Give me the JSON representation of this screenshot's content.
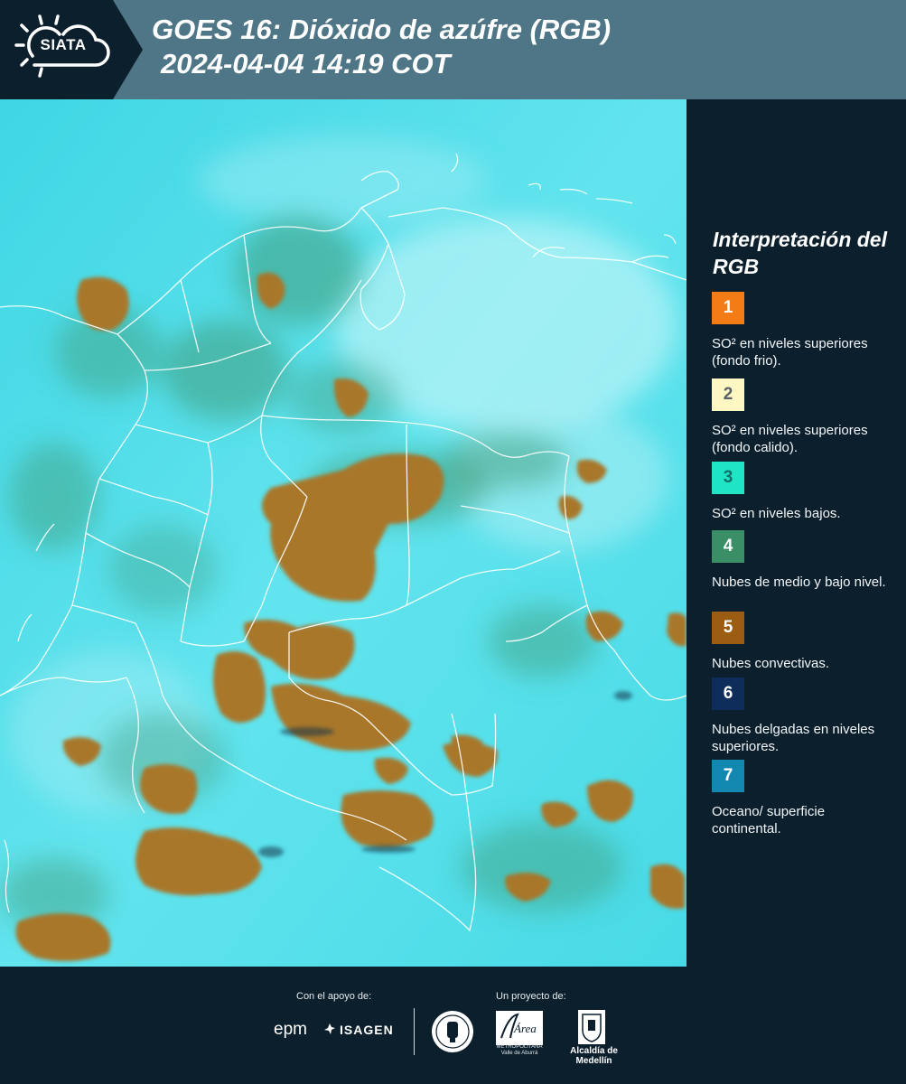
{
  "header": {
    "logo_text": "SIATA",
    "title_line1": "GOES 16: Dióxido de azúfre (RGB)",
    "title_line2": "2024-04-04 14:19 COT"
  },
  "legend": {
    "title": "Interpretación del RGB",
    "items": [
      {
        "number": "1",
        "color": "#f47c17",
        "number_color": "#ffffff",
        "text": "SO² en niveles superiores (fondo frio)."
      },
      {
        "number": "2",
        "color": "#fdf7c3",
        "number_color": "#5b6066",
        "text": "SO² en niveles superiores (fondo calido)."
      },
      {
        "number": "3",
        "color": "#1fe5c4",
        "number_color": "#0f6f6a",
        "text": "SO² en niveles bajos."
      },
      {
        "number": "4",
        "color": "#3a8f66",
        "number_color": "#ffffff",
        "text": "Nubes de medio y bajo nivel."
      },
      {
        "number": "5",
        "color": "#9a5d12",
        "number_color": "#ffffff",
        "text": "Nubes convectivas."
      },
      {
        "number": "6",
        "color": "#0f2d5a",
        "number_color": "#ffffff",
        "text": "Nubes delgadas en niveles superiores."
      },
      {
        "number": "7",
        "color": "#1287b0",
        "number_color": "#ffffff",
        "text": "Oceano/ superficie continental."
      }
    ]
  },
  "map": {
    "background_color": "#5ee3ec",
    "cloud_color": "#a8772b",
    "vegetation_color": "#3f9b77",
    "border_color": "#ffffff"
  },
  "footer": {
    "support_label": "Con el apoyo de:",
    "project_label": "Un proyecto de:",
    "epm": "epm",
    "isagen": "ISAGEN",
    "area_name": "Área",
    "area_sub": "METROPOLITANA Valle de Aburrá",
    "alcaldia": "Alcaldía de Medellín"
  }
}
